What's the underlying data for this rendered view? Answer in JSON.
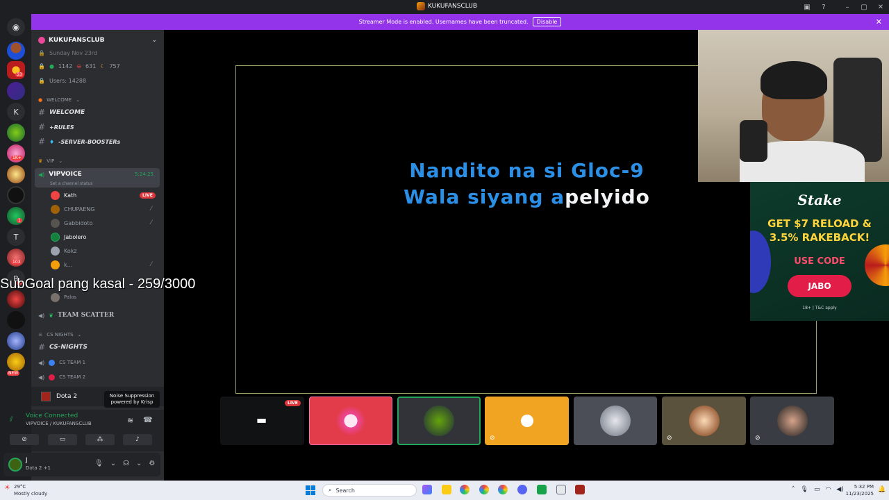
{
  "window": {
    "title": "KUKUFANSCLUB"
  },
  "banner": {
    "text": "Streamer Mode is enabled. Usernames have been truncated.",
    "disable_label": "Disable"
  },
  "server": {
    "name": "KUKUFANSCLUB",
    "date_row": "Sunday Nov 23rd",
    "stats": {
      "online": "1142",
      "dnd": "631",
      "idle": "757"
    },
    "users": "Users: 14288"
  },
  "categories": {
    "welcome": "WELCOME",
    "vip": "VIP",
    "cs_nights": "CS NIGHTS"
  },
  "channels": {
    "welcome": "WELCOME",
    "rules": "+RULES",
    "boosters": "-SERVER-BOOSTERs",
    "vipvoice": "VIPVOICE",
    "vipvoice_timer": "5:24:25",
    "vipvoice_status": "Set a channel status",
    "team_scatter": "TEAM SCATTER",
    "cs_nights": "CS-NIGHTS",
    "cs_team1": "CS TEAM 1",
    "cs_team2": "CS TEAM 2"
  },
  "voice_users": [
    {
      "name": "Kath",
      "live": "LIVE"
    },
    {
      "name": "CHUPAENG"
    },
    {
      "name": "Gabbidoto"
    },
    {
      "name": "Jabolero"
    },
    {
      "name": "Kokz"
    },
    {
      "name": "k..."
    },
    {
      "name": "Palos"
    }
  ],
  "game_activity": "Dota 2",
  "tooltip": {
    "line1": "Noise Suppression",
    "line2": "powered by Krisp"
  },
  "voice_status": {
    "connected": "Voice Connected",
    "channel": "VIPVOICE / KUKUFANSCLUB"
  },
  "user_panel": {
    "name": "J",
    "status": "Dota 2 +1"
  },
  "stream": {
    "lyric_line1": "Nandito na si Gloc-9",
    "lyric_line2_highlight": "Wala siyang a",
    "lyric_line2_rest": "pelyido"
  },
  "ad": {
    "brand": "Stake",
    "headline1": "GET $7 RELOAD &",
    "headline2": "3.5% RAKEBACK!",
    "code_label": "USE CODE",
    "code": "JABO",
    "fine": "18+ | T&C apply"
  },
  "tiles_live": "LIVE",
  "overlay_text": "SubGoal pang kasal - 259/3000",
  "rail": {
    "letter_k": "K",
    "letter_t": "T",
    "letter_b": "B",
    "badge_53": "53",
    "badge_1k": "1K+",
    "badge_1": "1",
    "badge_103": "103",
    "badge_new": "NEW",
    "badge_3": "3"
  },
  "taskbar": {
    "weather_temp": "29°C",
    "weather_desc": "Mostly cloudy",
    "search_placeholder": "Search",
    "time": "5:32 PM",
    "date": "11/23/2025"
  },
  "colors": {
    "accent": "#9333ea",
    "lyric_blue": "#2b8fe6",
    "voice_green": "#23a55a",
    "live_red": "#da373c"
  }
}
